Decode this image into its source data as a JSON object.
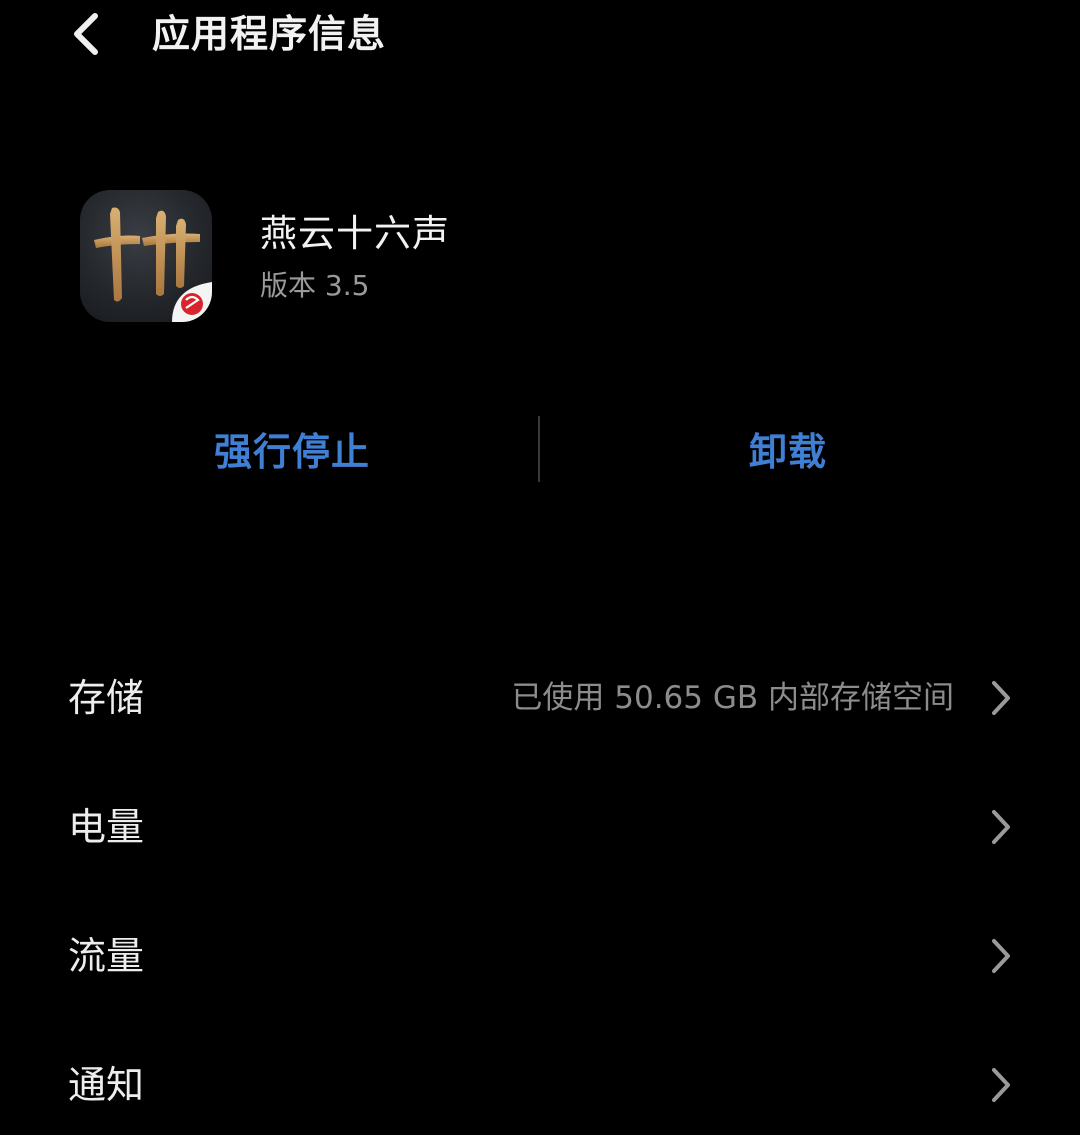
{
  "header": {
    "back_icon": "chevron-left-icon",
    "title": "应用程序信息"
  },
  "app": {
    "name": "燕云十六声",
    "version": "版本 3.5",
    "icon": "app-icon-yanyun",
    "icon_glyph": "卄"
  },
  "actions": {
    "force_stop_label": "强行停止",
    "uninstall_label": "卸载",
    "accent_color": "#3f7fd4"
  },
  "settings": [
    {
      "label": "存储",
      "value": "已使用 50.65 GB 内部存储空间",
      "icon": "chevron-right-icon"
    },
    {
      "label": "电量",
      "value": "",
      "icon": "chevron-right-icon"
    },
    {
      "label": "流量",
      "value": "",
      "icon": "chevron-right-icon"
    },
    {
      "label": "通知",
      "value": "",
      "icon": "chevron-right-icon"
    }
  ],
  "colors": {
    "background": "#000000",
    "text_primary": "#ededed",
    "text_secondary": "#8c8c8c"
  }
}
